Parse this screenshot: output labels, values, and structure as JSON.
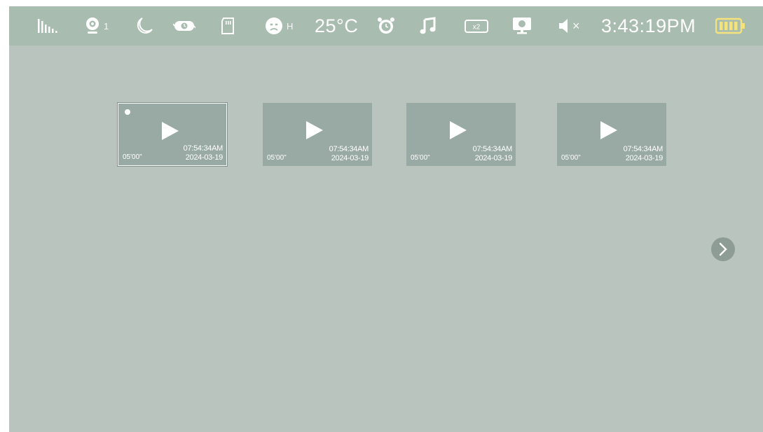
{
  "status_bar": {
    "icons": [
      "signal-bars-icon",
      "camera-icon",
      "moon-icon",
      "loop-icon",
      "sd-card-icon",
      "baby-face-icon",
      "alarm-clock-icon",
      "music-note-icon",
      "zoom-x2-icon",
      "screen-icon",
      "speaker-muted-icon",
      "battery-icon"
    ],
    "camera_number": "1",
    "face_label": "H",
    "temperature": "25°C",
    "muted_mark": "×",
    "clock": "3:43:19PM",
    "battery_level": 1.0
  },
  "colors": {
    "screen_bg": "#b9c4be",
    "status_bar_bg": "#a9bcb0",
    "thumbnail_bg": "#98aaa3",
    "foreground": "#ffffff"
  },
  "recordings": [
    {
      "duration": "05'00\"",
      "time": "07:54:34AM",
      "date": "2024-03-19",
      "selected": true
    },
    {
      "duration": "05'00\"",
      "time": "07:54:34AM",
      "date": "2024-03-19",
      "selected": false
    },
    {
      "duration": "05'00\"",
      "time": "07:54:34AM",
      "date": "2024-03-19",
      "selected": false
    },
    {
      "duration": "05'00\"",
      "time": "07:54:34AM",
      "date": "2024-03-19",
      "selected": false
    }
  ],
  "navigation": {
    "next_icon": "chevron-right-icon"
  }
}
